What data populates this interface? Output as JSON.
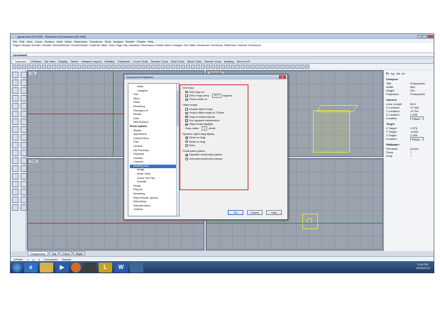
{
  "window": {
    "title": "gmail.com (376 KB) - Rhinoceros [Evaluation (84 left)]"
  },
  "menubar": {
    "items": [
      "File",
      "Edit",
      "View",
      "Curve",
      "Surface",
      "Solid",
      "Mesh",
      "Dimension",
      "Transform",
      "Tools",
      "Analyze",
      "Render",
      "Panels",
      "Help"
    ]
  },
  "command_history": [
    "Flags to display: Monster | Monster: MonsterRender: RenderGlobals: FocalDist: Wash: Undo: Flags: Airy: Animation: Dimensions: Default: Mesh: Lineages: Grid: Walls: Workbench: Renderery: SafeFrame: General: Dimensions"
  ],
  "command_prompt": "Command:",
  "tool_tabs": [
    "Standard",
    "CPlanes",
    "Set View",
    "Display",
    "Select",
    "Viewport Layout",
    "Visibility",
    "Transform",
    "Curve Tools",
    "Surface Tools",
    "Solid Tools",
    "Mesh Tools",
    "Render Tools",
    "Drafting",
    "New in V5"
  ],
  "viewports": {
    "top_left": "Top",
    "top_right": "Perspective",
    "bottom_left": "Front",
    "bottom_right": "Right"
  },
  "view_tabs": [
    "Perspective",
    "Top",
    "Front",
    "Right"
  ],
  "osnap": [
    "CPlane",
    "x",
    "y",
    "z",
    "Exclusions",
    "Default"
  ],
  "statusbar": [
    "Grid Snap",
    "Ortho",
    "Planar",
    "Osnap",
    "SmartTrack",
    "Gumball",
    "Record History",
    "Filter",
    "Minutes from last save: 54"
  ],
  "right_panel": {
    "tabs": [
      "Pr",
      "Ly",
      "Lb",
      "Lr"
    ],
    "sections": {
      "viewport": "Viewport",
      "camera": "Camera",
      "target": "Target",
      "wallpaper": "Wallpaper"
    },
    "viewport_rows": [
      [
        "Title",
        "Perspective"
      ],
      [
        "Width",
        "665"
      ],
      [
        "Height",
        "331"
      ],
      [
        "Projection",
        "Perspective"
      ]
    ],
    "camera_rows": [
      [
        "Lens Length",
        "50.0"
      ],
      [
        "X Location",
        "97.354"
      ],
      [
        "Y Location",
        "-8.704"
      ],
      [
        "Z Location",
        "2.456"
      ],
      [
        "Location",
        "Place..."
      ]
    ],
    "target_rows": [
      [
        "X Target",
        "2.575"
      ],
      [
        "Y Target",
        "-6.843"
      ],
      [
        "Z Target",
        "2.288"
      ],
      [
        "Location",
        "Place..."
      ]
    ],
    "wallpaper_rows": [
      [
        "Filename",
        "(none)"
      ],
      [
        "Show",
        "✓"
      ],
      [
        "Gray",
        "✓"
      ]
    ]
  },
  "taskbar": {
    "time": "8:26 PM",
    "date": "15/06/2013",
    "apps": [
      "start",
      "ie",
      "explorer",
      "media",
      "chrome",
      "office",
      "rhino",
      "word",
      "rhino5"
    ]
  },
  "dialog": {
    "title": "Document Properties",
    "close_label": "✕",
    "tree_items": [
      {
        "label": "Hatch",
        "bold": false,
        "sel": false,
        "indent": 2
      },
      {
        "label": "Linetypes",
        "bold": false,
        "sel": false,
        "indent": 2
      },
      {
        "label": "Grid",
        "bold": false,
        "sel": false,
        "indent": 1
      },
      {
        "label": "Mesh",
        "bold": false,
        "sel": false,
        "indent": 1
      },
      {
        "label": "Notes",
        "bold": false,
        "sel": false,
        "indent": 1
      },
      {
        "label": "Rendering",
        "bold": false,
        "sel": false,
        "indent": 1
      },
      {
        "label": "Flamingo nXt",
        "bold": false,
        "sel": false,
        "indent": 1
      },
      {
        "label": "Render",
        "bold": false,
        "sel": false,
        "indent": 1
      },
      {
        "label": "Units",
        "bold": false,
        "sel": false,
        "indent": 1
      },
      {
        "label": "Web Browser",
        "bold": false,
        "sel": false,
        "indent": 1
      },
      {
        "label": "Rhino Options",
        "bold": true,
        "sel": false,
        "indent": 0
      },
      {
        "label": "Aliases",
        "bold": false,
        "sel": false,
        "indent": 1
      },
      {
        "label": "Appearance",
        "bold": false,
        "sel": false,
        "indent": 1
      },
      {
        "label": "Context Menu",
        "bold": false,
        "sel": false,
        "indent": 1
      },
      {
        "label": "Files",
        "bold": false,
        "sel": false,
        "indent": 1
      },
      {
        "label": "General",
        "bold": false,
        "sel": false,
        "indent": 1
      },
      {
        "label": "Idle Processor",
        "bold": false,
        "sel": false,
        "indent": 1
      },
      {
        "label": "Keyboard",
        "bold": false,
        "sel": false,
        "indent": 1
      },
      {
        "label": "Libraries",
        "bold": false,
        "sel": false,
        "indent": 1
      },
      {
        "label": "Licenses",
        "bold": false,
        "sel": false,
        "indent": 1
      },
      {
        "label": "Modeling Aids",
        "bold": false,
        "sel": true,
        "indent": 1
      },
      {
        "label": "Nudge",
        "bold": false,
        "sel": false,
        "indent": 2
      },
      {
        "label": "Smart Track",
        "bold": false,
        "sel": false,
        "indent": 2
      },
      {
        "label": "Cursor Tool Tips",
        "bold": false,
        "sel": false,
        "indent": 2
      },
      {
        "label": "Gumball",
        "bold": false,
        "sel": false,
        "indent": 2
      },
      {
        "label": "Mouse",
        "bold": false,
        "sel": false,
        "indent": 1
      },
      {
        "label": "Plug-ins",
        "bold": false,
        "sel": false,
        "indent": 1
      },
      {
        "label": "Rendering",
        "bold": false,
        "sel": false,
        "indent": 1
      },
      {
        "label": "Rhino Render Options",
        "bold": false,
        "sel": false,
        "indent": 1
      },
      {
        "label": "RhinoScript",
        "bold": false,
        "sel": false,
        "indent": 1
      },
      {
        "label": "Selection Menu",
        "bold": false,
        "sel": false,
        "indent": 1
      },
      {
        "label": "Toolbars",
        "bold": false,
        "sel": false,
        "indent": 1
      }
    ],
    "grid_snap_group": "Grid snap",
    "grid_snap_on": "Grid Snap on",
    "ortho_snap": "Ortho Snap every",
    "ortho_value": "90.0",
    "ortho_unit": "degrees",
    "planar_mode": "Planar mode on",
    "object_snaps_group": "Object snaps",
    "disable_snaps": "Disable object snaps",
    "project_snaps": "Project object snaps to CPlane",
    "snap_locked": "Snap to locked objects",
    "use_apparent": "Use apparent intersections",
    "osnap_highlight": "Object snap highlight",
    "snap_radius_label": "Snap radius",
    "snap_radius_value": "8",
    "snap_radius_unit": "pixels",
    "drag_group": "Dynamic object drag display",
    "drag_opt1": "Ghost on drag",
    "drag_opt2": "Wires on drag",
    "drag_opt3": "None",
    "cplanes_group": "Construction planes",
    "cplane_opt1": "Standard construction planes",
    "cplane_opt2": "Universal construction planes",
    "ok": "OK",
    "cancel": "Cancel",
    "help": "Help"
  }
}
